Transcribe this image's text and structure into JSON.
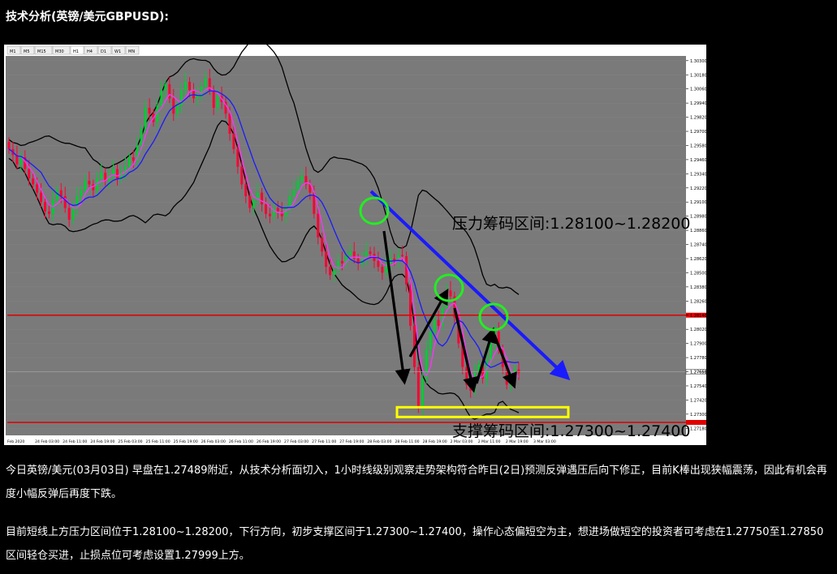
{
  "heading": "技术分析(英镑/美元GBPUSD):",
  "colors": {
    "background": "#000000",
    "chart_bg": "#7a7a7a",
    "bull_candle": "#00cc33",
    "bear_candle": "#ff0033",
    "ma_fast": "#ff33ff",
    "ma_slow": "#1a1aff",
    "bollinger": "#000000",
    "resistance_line": "#e00000",
    "trend_arrow": "#1a1aff",
    "circle": "#22ee22",
    "support_box": "#ffff00"
  },
  "chart": {
    "timeframe_tabs": [
      "M1",
      "M5",
      "M15",
      "M30",
      "H1",
      "H4",
      "D1",
      "W1",
      "MN"
    ],
    "price_price_label": "1.27659",
    "resistance_label": "压力筹码区间:1.28100~1.28200",
    "support_label": "支撑筹码区间:1.27300~1.27400"
  },
  "chart_data": {
    "type": "candlestick",
    "symbol": "GBPUSD",
    "timeframe": "H1",
    "y_ticks": [
      "1.30300",
      "1.30180",
      "1.30060",
      "1.29940",
      "1.29820",
      "1.29700",
      "1.29580",
      "1.29460",
      "1.29340",
      "1.29220",
      "1.29100",
      "1.28980",
      "1.28860",
      "1.28740",
      "1.28620",
      "1.28500",
      "1.28380",
      "1.28260",
      "1.28140",
      "1.28020",
      "1.27900",
      "1.27780",
      "1.27660",
      "1.27540",
      "1.27420",
      "1.27300",
      "1.27180"
    ],
    "x_ticks": [
      "Feb 2020",
      "24 Feb 03:00",
      "24 Feb 11:00",
      "24 Feb 19:00",
      "25 Feb 03:00",
      "25 Feb 11:00",
      "25 Feb 19:00",
      "26 Feb 03:00",
      "26 Feb 11:00",
      "26 Feb 19:00",
      "27 Feb 03:00",
      "27 Feb 11:00",
      "27 Feb 19:00",
      "28 Feb 03:00",
      "28 Feb 11:00",
      "28 Feb 19:00",
      "2 Mar 03:00",
      "2 Mar 11:00",
      "2 Mar 19:00",
      "3 Mar 03:00"
    ],
    "ylim": [
      1.2712,
      1.3034
    ],
    "current_price": 1.27659,
    "resistance_lines": [
      1.2814,
      1.2723
    ],
    "resistance_zone": [
      1.281,
      1.282
    ],
    "support_zone": [
      1.273,
      1.274
    ],
    "closes": [
      1.2955,
      1.295,
      1.2942,
      1.2948,
      1.2938,
      1.293,
      1.2925,
      1.2918,
      1.291,
      1.2902,
      1.29,
      1.2912,
      1.292,
      1.2915,
      1.2905,
      1.2895,
      1.2905,
      1.2915,
      1.292,
      1.2928,
      1.2925,
      1.292,
      1.293,
      1.2935,
      1.2928,
      1.2932,
      1.2938,
      1.293,
      1.2935,
      1.294,
      1.2948,
      1.2945,
      1.2958,
      1.2972,
      1.299,
      1.2985,
      1.2978,
      1.2992,
      1.3005,
      1.301,
      1.2998,
      1.2985,
      1.2992,
      1.3005,
      1.3012,
      1.3005,
      1.2998,
      1.3,
      1.3008,
      1.3015,
      1.3005,
      1.299,
      1.3,
      1.2995,
      1.2985,
      1.2968,
      1.2955,
      1.294,
      1.2925,
      1.2915,
      1.2905,
      1.2912,
      1.2918,
      1.2908,
      1.29,
      1.2898,
      1.2905,
      1.2902,
      1.2898,
      1.2905,
      1.2915,
      1.292,
      1.2928,
      1.2932,
      1.2925,
      1.2918,
      1.29,
      1.288,
      1.2868,
      1.2855,
      1.2848,
      1.2852,
      1.286,
      1.2858,
      1.2865,
      1.2868,
      1.2862,
      1.2858,
      1.2862,
      1.2868,
      1.2866,
      1.286,
      1.2855,
      1.285,
      1.2858,
      1.2862,
      1.286,
      1.2865,
      1.2864,
      1.284,
      1.2805,
      1.277,
      1.2735,
      1.276,
      1.2785,
      1.28,
      1.281,
      1.2805,
      1.282,
      1.2835,
      1.283,
      1.2812,
      1.279,
      1.277,
      1.2755,
      1.275,
      1.2765,
      1.2772,
      1.276,
      1.2775,
      1.279,
      1.28,
      1.2785,
      1.277,
      1.2755,
      1.276,
      1.2768,
      1.2765
    ]
  },
  "paragraphs": [
    "今日英镑/美元(03月03日) 早盘在1.27489附近，从技术分析面切入，1小时线级别观察走势架构符合昨日(2日)预测反弹遇压后向下修正，目前K棒出现狭幅震荡，因此有机会再度小幅反弹后再度下跌。",
    "目前短线上方压力区间位于1.28100~1.28200，下行方向，初步支撑区间于1.27300~1.27400，操作心态偏短空为主，想进场做短空的投资者可考虑在1.27750至1.27850区间轻仓买进，止损点位可考虑设置1.27999上方。"
  ]
}
